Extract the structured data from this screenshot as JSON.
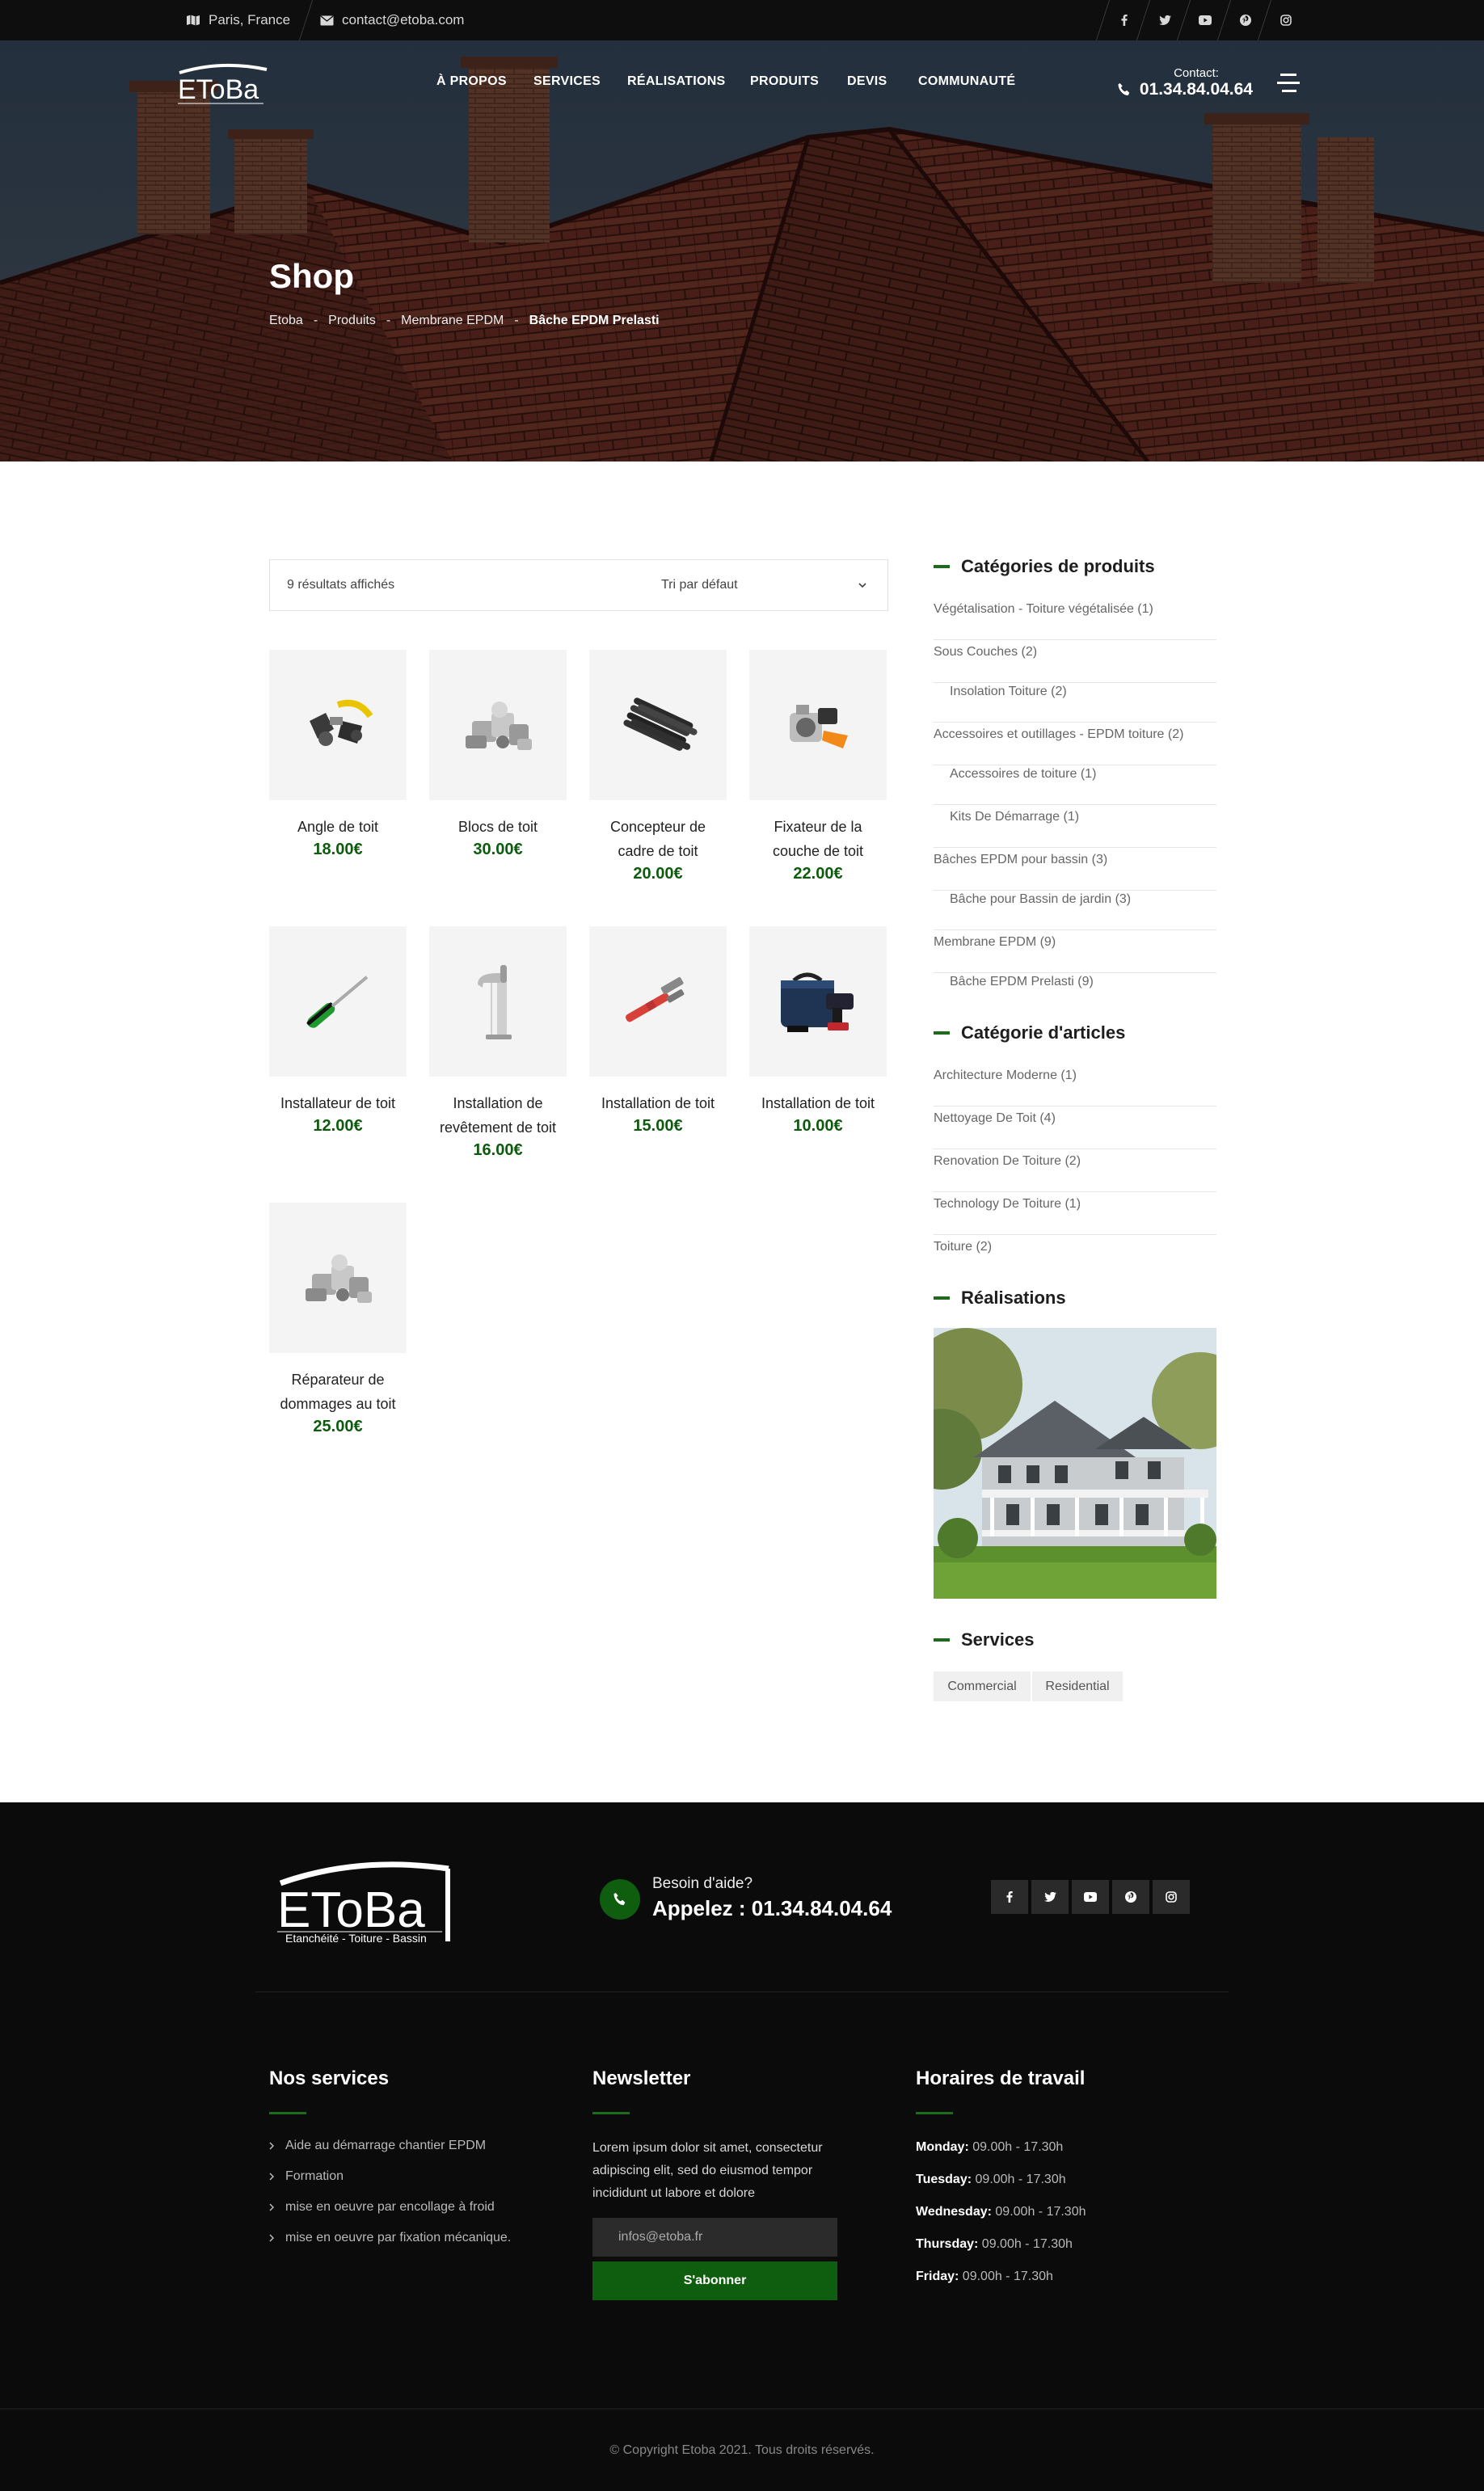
{
  "topbar": {
    "location": "Paris, France",
    "email": "contact@etoba.com",
    "social_icons": [
      "facebook-icon",
      "twitter-icon",
      "youtube-icon",
      "pinterest-icon",
      "instagram-icon"
    ]
  },
  "header": {
    "logo_text": "EToBa",
    "nav": [
      "À PROPOS",
      "SERVICES",
      "RÉALISATIONS",
      "PRODUITS",
      "DEVIS",
      "COMMUNAUTÉ"
    ],
    "contact_label": "Contact:",
    "contact_phone": "01.34.84.04.64"
  },
  "hero": {
    "title": "Shop",
    "breadcrumb": [
      "Etoba",
      "Produits",
      "Membrane EPDM",
      "Bâche EPDM Prelasti"
    ],
    "breadcrumb_sep": "-"
  },
  "shop": {
    "result_count": "9 résultats affichés",
    "sort_label": "Tri par défaut",
    "products": [
      {
        "name_lines": [
          "Angle de toit"
        ],
        "price": "18.00€"
      },
      {
        "name_lines": [
          "Blocs de toit"
        ],
        "price": "30.00€"
      },
      {
        "name_lines": [
          "Concepteur de",
          "cadre de toit"
        ],
        "price": "20.00€"
      },
      {
        "name_lines": [
          "Fixateur de la",
          "couche de toit"
        ],
        "price": "22.00€"
      },
      {
        "name_lines": [
          "Installateur de toit"
        ],
        "price": "12.00€"
      },
      {
        "name_lines": [
          "Installation de",
          "revêtement de toit"
        ],
        "price": "16.00€"
      },
      {
        "name_lines": [
          "Installation de toit"
        ],
        "price": "15.00€"
      },
      {
        "name_lines": [
          "Installation de toit"
        ],
        "price": "10.00€"
      },
      {
        "name_lines": [
          "Réparateur de",
          "dommages au toit"
        ],
        "price": "25.00€"
      }
    ]
  },
  "sidebar": {
    "cat_heading": "Catégories de produits",
    "categories": [
      {
        "label": "Végétalisation - Toiture végétalisée (1)",
        "sub": false
      },
      {
        "label": "Sous Couches (2)",
        "sub": false
      },
      {
        "label": "Insolation Toiture (2)",
        "sub": true
      },
      {
        "label": "Accessoires et outillages - EPDM toiture (2)",
        "sub": false
      },
      {
        "label": "Accessoires de toiture (1)",
        "sub": true
      },
      {
        "label": "Kits De Démarrage (1)",
        "sub": true
      },
      {
        "label": "Bâches EPDM pour bassin (3)",
        "sub": false
      },
      {
        "label": "Bâche pour Bassin de jardin (3)",
        "sub": true
      },
      {
        "label": "Membrane EPDM (9)",
        "sub": false
      },
      {
        "label": "Bâche EPDM Prelasti (9)",
        "sub": true
      }
    ],
    "art_heading": "Catégorie d'articles",
    "articles": [
      "Architecture Moderne (1)",
      "Nettoyage De Toit (4)",
      "Renovation De Toiture (2)",
      "Technology De Toiture (1)",
      "Toiture (2)"
    ],
    "real_heading": "Réalisations",
    "services_heading": "Services",
    "tags": [
      "Commercial",
      "Residential"
    ]
  },
  "footer": {
    "logo_text": "EToBa",
    "logo_tagline": "Etanchéité - Toiture - Bassin",
    "help_label": "Besoin d'aide?",
    "help_phone": "Appelez : 01.34.84.04.64",
    "services_heading": "Nos services",
    "services": [
      "Aide au démarrage chantier EPDM",
      "Formation",
      "mise en oeuvre par encollage à froid",
      "mise en oeuvre par fixation mécanique."
    ],
    "newsletter_heading": "Newsletter",
    "newsletter_text": "Lorem ipsum dolor sit amet, consectetur adipiscing elit, sed do eiusmod tempor incididunt ut labore et dolore",
    "email_placeholder": "infos@etoba.fr",
    "subscribe_label": "S'abonner",
    "hours_heading": "Horaires de travail",
    "hours": [
      {
        "day": "Monday:",
        "time": "09.00h - 17.30h"
      },
      {
        "day": "Tuesday:",
        "time": "09.00h - 17.30h"
      },
      {
        "day": "Wednesday:",
        "time": "09.00h - 17.30h"
      },
      {
        "day": "Thursday:",
        "time": "09.00h - 17.30h"
      },
      {
        "day": "Friday:",
        "time": "09.00h - 17.30h"
      }
    ],
    "copyright": "© Copyright Etoba 2021. Tous droits réservés.",
    "accent_color": "#0f5e0f"
  }
}
